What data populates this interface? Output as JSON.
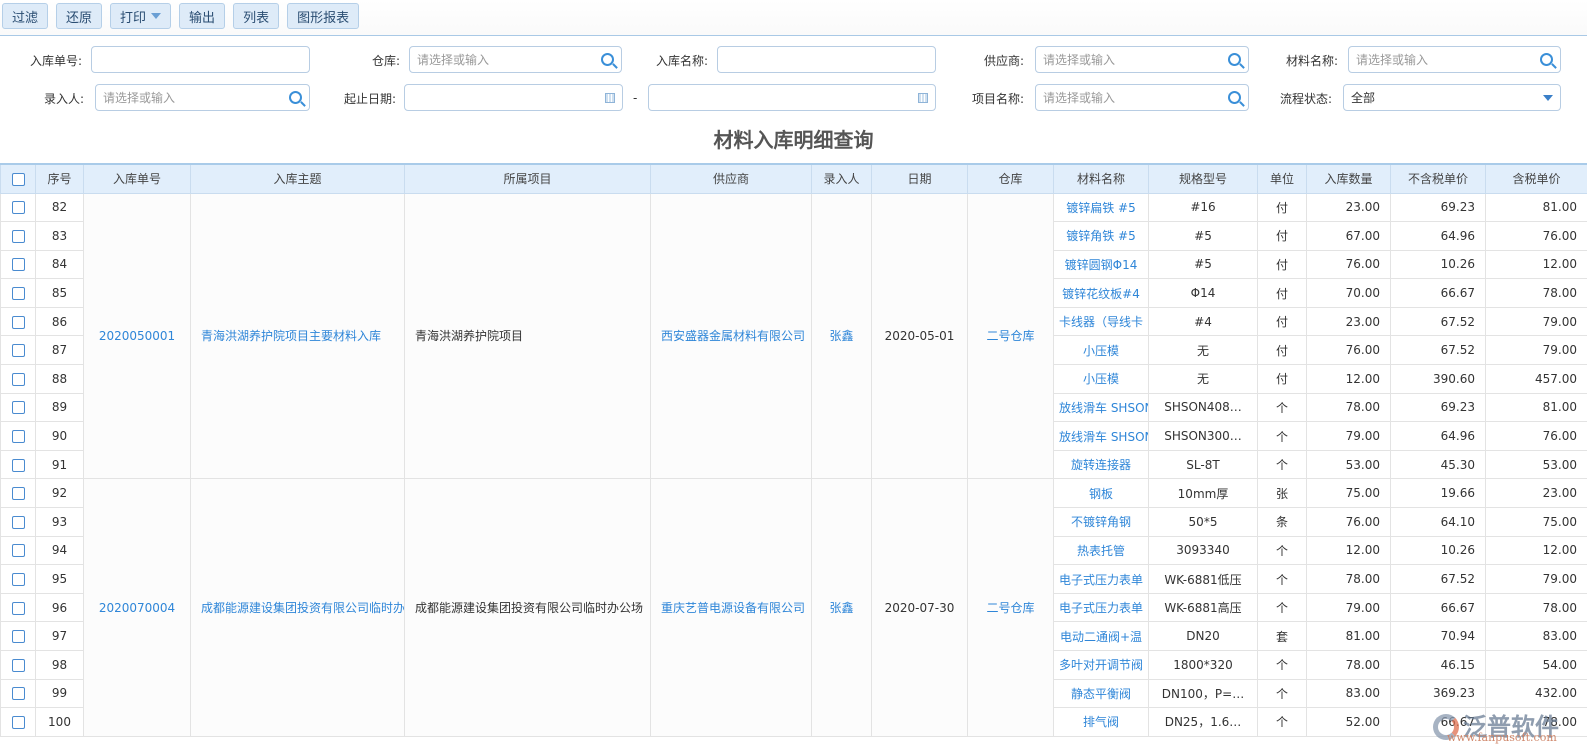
{
  "toolbar": {
    "buttons": [
      "过滤",
      "还原",
      "打印",
      "输出",
      "列表",
      "图形报表"
    ]
  },
  "filters": {
    "inbound_no": {
      "label": "入库单号:",
      "value": ""
    },
    "warehouse": {
      "label": "仓库:",
      "placeholder": "请选择或输入"
    },
    "inbound_name": {
      "label": "入库名称:",
      "value": ""
    },
    "supplier": {
      "label": "供应商:",
      "placeholder": "请选择或输入"
    },
    "material_name": {
      "label": "材料名称:",
      "placeholder": "请选择或输入"
    },
    "entered_by": {
      "label": "录入人:",
      "placeholder": "请选择或输入"
    },
    "date_range": {
      "label": "起止日期:",
      "start": "",
      "end": "",
      "separator": "-"
    },
    "project_name": {
      "label": "项目名称:",
      "placeholder": "请选择或输入"
    },
    "flow_status": {
      "label": "流程状态:",
      "value": "全部"
    }
  },
  "page_title": "材料入库明细查询",
  "table": {
    "columns": [
      "序号",
      "入库单号",
      "入库主题",
      "所属项目",
      "供应商",
      "录入人",
      "日期",
      "仓库",
      "材料名称",
      "规格型号",
      "单位",
      "入库数量",
      "不含税单价",
      "含税单价"
    ],
    "groups": [
      {
        "no": "2020050001",
        "subject": "青海洪湖养护院项目主要材料入库",
        "project": "青海洪湖养护院项目",
        "supplier": "西安盛器金属材料有限公司",
        "entered_by": "张鑫",
        "date": "2020-05-01",
        "warehouse": "二号仓库",
        "rows": [
          [
            "82",
            "镀锌扁铁 #5",
            "#16",
            "付",
            "23.00",
            "69.23",
            "81.00"
          ],
          [
            "83",
            "镀锌角铁 #5",
            "#5",
            "付",
            "67.00",
            "64.96",
            "76.00"
          ],
          [
            "84",
            "镀锌圆钢Φ14",
            "#5",
            "付",
            "76.00",
            "10.26",
            "12.00"
          ],
          [
            "85",
            "镀锌花纹板#4",
            "Φ14",
            "付",
            "70.00",
            "66.67",
            "78.00"
          ],
          [
            "86",
            "卡线器（导线卡",
            "#4",
            "付",
            "23.00",
            "67.52",
            "79.00"
          ],
          [
            "87",
            "小压模",
            "无",
            "付",
            "76.00",
            "67.52",
            "79.00"
          ],
          [
            "88",
            "小压模",
            "无",
            "付",
            "12.00",
            "390.60",
            "457.00"
          ],
          [
            "89",
            "放线滑车 SHSON",
            "SHSON408…",
            "个",
            "78.00",
            "69.23",
            "81.00"
          ],
          [
            "90",
            "放线滑车 SHSON",
            "SHSON300…",
            "个",
            "79.00",
            "64.96",
            "76.00"
          ],
          [
            "91",
            "旋转连接器",
            "SL-8T",
            "个",
            "53.00",
            "45.30",
            "53.00"
          ]
        ]
      },
      {
        "no": "2020070004",
        "subject": "成都能源建设集团投资有限公司临时办公",
        "project": "成都能源建设集团投资有限公司临时办公场",
        "supplier": "重庆艺普电源设备有限公司",
        "entered_by": "张鑫",
        "date": "2020-07-30",
        "warehouse": "二号仓库",
        "rows": [
          [
            "92",
            "钢板",
            "10mm厚",
            "张",
            "75.00",
            "19.66",
            "23.00"
          ],
          [
            "93",
            "不镀锌角钢",
            "50*5",
            "条",
            "76.00",
            "64.10",
            "75.00"
          ],
          [
            "94",
            "热表托管",
            "3093340",
            "个",
            "12.00",
            "10.26",
            "12.00"
          ],
          [
            "95",
            "电子式压力表单",
            "WK-6881低压",
            "个",
            "78.00",
            "67.52",
            "79.00"
          ],
          [
            "96",
            "电子式压力表单",
            "WK-6881高压",
            "个",
            "79.00",
            "66.67",
            "78.00"
          ],
          [
            "97",
            "电动二通阀+温",
            "DN20",
            "套",
            "81.00",
            "70.94",
            "83.00"
          ],
          [
            "98",
            "多叶对开调节阀",
            "1800*320",
            "个",
            "78.00",
            "46.15",
            "54.00"
          ],
          [
            "99",
            "静态平衡阀",
            "DN100，P=…",
            "个",
            "83.00",
            "369.23",
            "432.00"
          ],
          [
            "100",
            "排气阀",
            "DN25，1.6…",
            "个",
            "52.00",
            "66.67",
            "78.00"
          ]
        ]
      }
    ]
  },
  "watermark": {
    "brand": "泛普软件",
    "url": "www.fanpusoft.com"
  },
  "colors": {
    "accent": "#2f86d8",
    "header_bg": "#e1eefb",
    "button_bg": "#deebf8"
  }
}
